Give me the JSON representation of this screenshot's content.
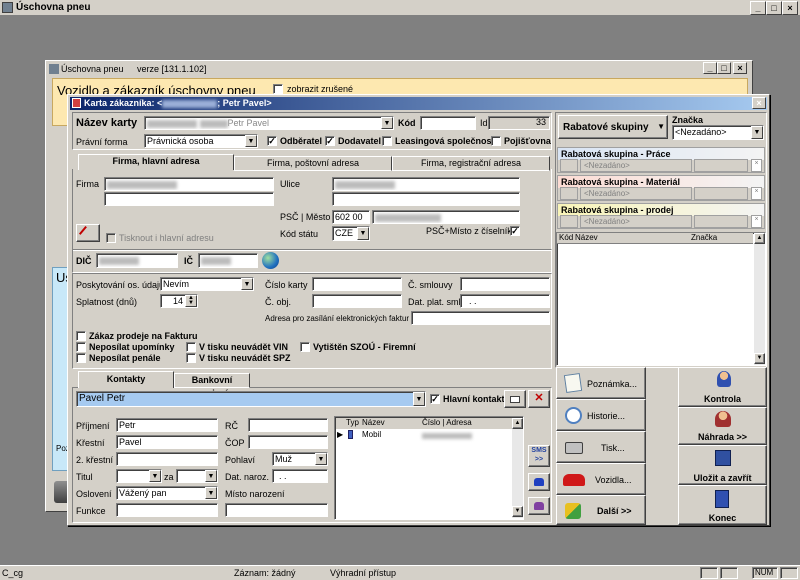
{
  "app": {
    "title": "Úschovna pneu"
  },
  "status": {
    "left": "C_cg",
    "record": "Záznam: žádný",
    "access": "Výhradní přístup",
    "num": "NUM"
  },
  "back": {
    "title": "Úschovna pneu",
    "version": "verze [131.1.102]",
    "header": "Vozidlo a zákazník úschovny pneu",
    "checkbox": "zobrazit zrušené",
    "us": "Us",
    "poz": "Poz"
  },
  "dialog": {
    "title_prefix": "Karta zákazníka: <",
    "title_suffix": "; Petr Pavel>"
  },
  "form": {
    "nazev_label": "Název karty",
    "nazev_suffix": "Petr Pavel",
    "kod_label": "Kód",
    "id_label": "Id",
    "id_value": "33",
    "pravni_label": "Právní forma",
    "pravni_value": "Právnická osoba",
    "odberatel": "Odběratel",
    "dodavatel": "Dodavatel",
    "leasing": "Leasingová společnost",
    "pojistovna": "Pojišťovna",
    "tabs": [
      "Firma, hlavní adresa",
      "Firma, poštovní adresa",
      "Firma, registrační adresa"
    ],
    "firma_label": "Firma",
    "ulice_label": "Ulice",
    "psc_label": "PSČ | Město",
    "psc_value": "602 00",
    "kod_statu_label": "Kód státu",
    "kod_statu_value": "CZE",
    "psc_ciselnik": "PSČ+Místo z číselníku",
    "tisknout": "Tisknout i hlavní adresu",
    "dic_label": "DIČ",
    "ic_label": "IČ",
    "poskytovani_label": "Poskytování os. údajů",
    "poskytovani_value": "Nevím",
    "cislo_karty_label": "Číslo karty",
    "c_smlouvy_label": "Č. smlouvy",
    "splatnost_label": "Splatnost (dnů)",
    "splatnost_value": "14",
    "c_obj_label": "Č. obj.",
    "dat_plat_label": "Dat. plat. sml.",
    "dat_plat_value": ". .",
    "adresa_fakt_label": "Adresa pro zasílání elektronických faktur",
    "zakaz": "Zákaz prodeje na Fakturu",
    "neposilat_upom": "Neposílat upomínky",
    "neposilat_pen": "Neposílat penále",
    "v_tisku_vin": "V tisku neuvádět VIN",
    "v_tisku_spz": "V tisku neuvádět SPZ",
    "vytisten": "Vytištěn SZOÚ - Firemní",
    "ctabs": [
      "Kontakty",
      "Bankovní spojení"
    ],
    "contact_name": "Pavel Petr",
    "hlavni_kontakt": "Hlavní kontakt",
    "prijmeni_label": "Příjmení",
    "prijmeni_value": "Petr",
    "rc_label": "RČ",
    "krestni_label": "Křestní",
    "krestni_value": "Pavel",
    "cop_label": "ČOP",
    "krestni2_label": "2. křestní",
    "pohlavi_label": "Pohlaví",
    "pohlavi_value": "Muž",
    "titul_label": "Titul",
    "za_label": "za",
    "dat_naroz_label": "Dat. naroz.",
    "dat_naroz_value": ". .",
    "osloveni_label": "Oslovení",
    "osloveni_value": "Vážený pan",
    "misto_label": "Místo narození",
    "funkce_label": "Funkce",
    "grid_headers": [
      "Typ",
      "Název",
      "Číslo | Adresa"
    ],
    "grid_row_name": "Mobil",
    "sms": "SMS"
  },
  "right": {
    "rabat_label": "Rabatové skupiny",
    "znacka_label": "Značka",
    "znacka_value": "<Nezadáno>",
    "groups": [
      {
        "title": "Rabatová skupina - Práce",
        "value": "<Nezadáno>"
      },
      {
        "title": "Rabatová skupina - Materiál",
        "value": "<Nezadáno>"
      },
      {
        "title": "Rabatová skupina - prodej",
        "value": "<Nezadáno>"
      }
    ],
    "list_headers": [
      "Kód",
      "Název",
      "Značka"
    ]
  },
  "buttons": {
    "poznamka": "Poznámka...",
    "historie": "Historie...",
    "tisk": "Tisk...",
    "vozidla": "Vozidla...",
    "dalsi": "Další >>",
    "kontrola": "Kontrola",
    "nahrada": "Náhrada >>",
    "ulozit": "Uložit a zavřít",
    "konec": "Konec"
  },
  "colors": {
    "titlebar": "#0a246a",
    "face": "#d4d0c8",
    "selection": "#a6caf0"
  }
}
